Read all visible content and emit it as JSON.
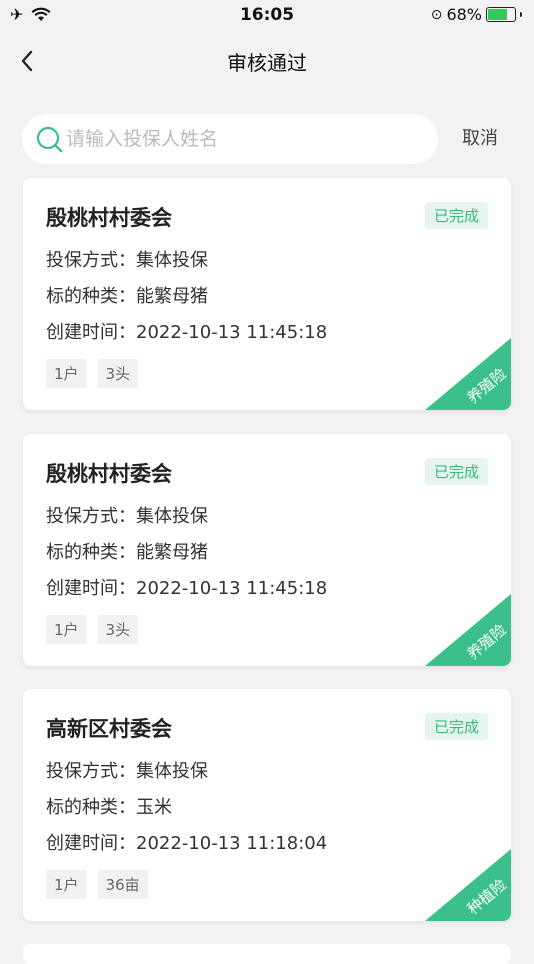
{
  "status_bar": {
    "time": "16:05",
    "battery": "68%",
    "battery_level": 0.68
  },
  "nav": {
    "title": "审核通过"
  },
  "search": {
    "placeholder": "请输入投保人姓名",
    "value": "",
    "cancel_label": "取消"
  },
  "colors": {
    "accent": "#3cc08b",
    "badge_bg": "#e3f5ee",
    "badge_text": "#3cb882",
    "page_bg": "#f2f2f4"
  },
  "cards": [
    {
      "title": "殷桃村村委会",
      "status": "已完成",
      "method": "投保方式：集体投保",
      "type": "标的种类：能繁母猪",
      "created": "创建时间：2022-10-13 11:45:18",
      "tags": [
        "1户",
        "3头"
      ],
      "corner": "养殖险"
    },
    {
      "title": "殷桃村村委会",
      "status": "已完成",
      "method": "投保方式：集体投保",
      "type": "标的种类：能繁母猪",
      "created": "创建时间：2022-10-13 11:45:18",
      "tags": [
        "1户",
        "3头"
      ],
      "corner": "养殖险"
    },
    {
      "title": "高新区村委会",
      "status": "已完成",
      "method": "投保方式：集体投保",
      "type": "标的种类：玉米",
      "created": "创建时间：2022-10-13 11:18:04",
      "tags": [
        "1户",
        "36亩"
      ],
      "corner": "种植险"
    }
  ]
}
